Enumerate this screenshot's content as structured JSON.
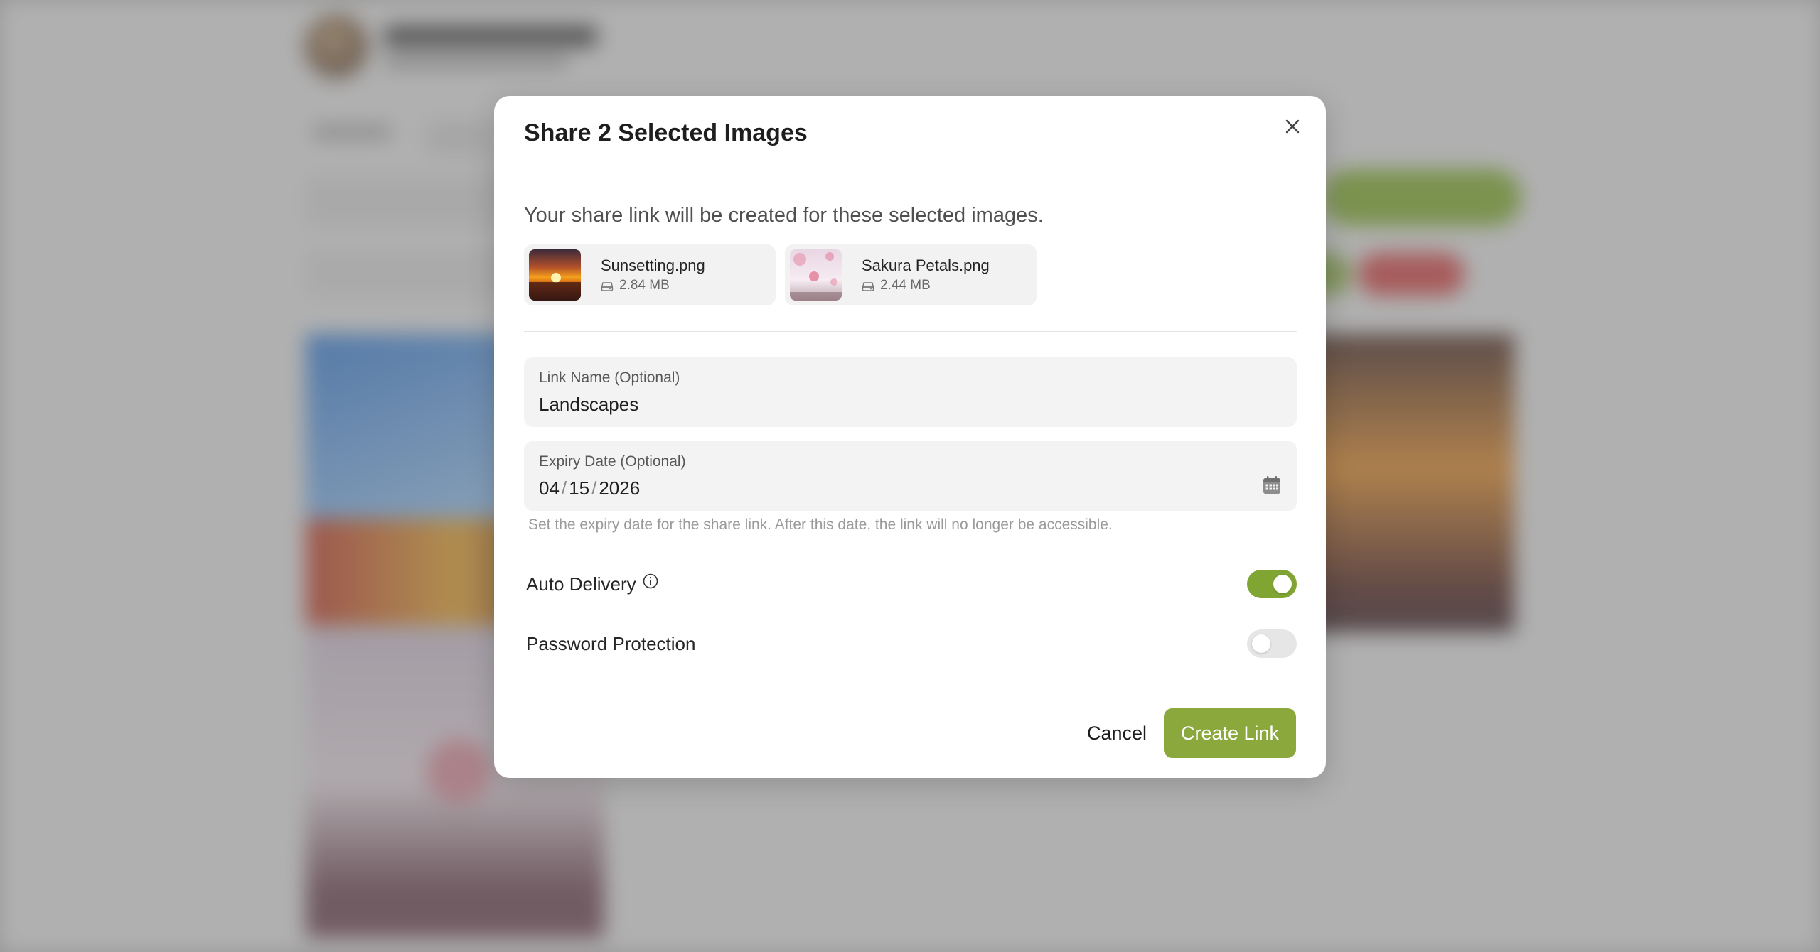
{
  "dialog": {
    "title": "Share 2 Selected Images",
    "intro": "Your share link will be created for these selected images.",
    "files": [
      {
        "name": "Sunsetting.png",
        "size": "2.84 MB",
        "thumbnail": "sunset-thumbnail"
      },
      {
        "name": "Sakura Petals.png",
        "size": "2.44 MB",
        "thumbnail": "sakura-thumbnail"
      }
    ],
    "link_name": {
      "label": "Link Name (Optional)",
      "value": "Landscapes"
    },
    "expiry_date": {
      "label": "Expiry Date (Optional)",
      "month": "04",
      "day": "15",
      "year": "2026",
      "separator": "/",
      "helper": "Set the expiry date for the share link. After this date, the link will no longer be accessible."
    },
    "auto_delivery": {
      "label": "Auto Delivery",
      "enabled": true
    },
    "password_protection": {
      "label": "Password Protection",
      "enabled": false
    },
    "buttons": {
      "cancel": "Cancel",
      "create": "Create Link"
    }
  },
  "colors": {
    "accent": "#8aa83c",
    "toggle_on": "#80a532",
    "toggle_off": "#e6e6e6"
  },
  "icons": [
    "close-icon",
    "drive-icon",
    "calendar-icon",
    "info-icon"
  ]
}
